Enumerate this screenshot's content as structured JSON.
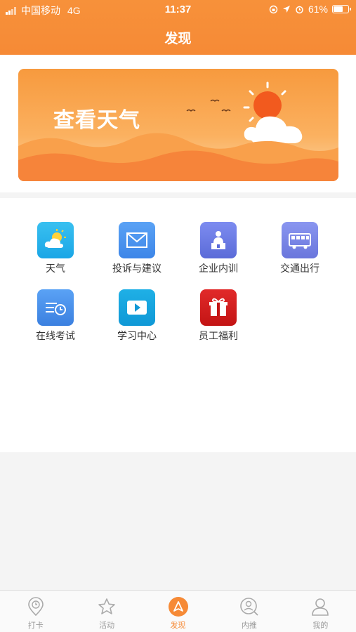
{
  "status_bar": {
    "carrier": "中国移动",
    "network": "4G",
    "time": "11:37",
    "battery": "61%"
  },
  "header": {
    "title": "发现"
  },
  "banner": {
    "text": "查看天气"
  },
  "features": [
    {
      "label": "天气"
    },
    {
      "label": "投诉与建议"
    },
    {
      "label": "企业内训"
    },
    {
      "label": "交通出行"
    },
    {
      "label": "在线考试"
    },
    {
      "label": "学习中心"
    },
    {
      "label": "员工福利"
    }
  ],
  "tabbar": [
    {
      "label": "打卡"
    },
    {
      "label": "活动"
    },
    {
      "label": "发现",
      "active": true
    },
    {
      "label": "内推"
    },
    {
      "label": "我的"
    }
  ],
  "colors": {
    "accent": "#f68a36",
    "tab_inactive": "#999999"
  }
}
